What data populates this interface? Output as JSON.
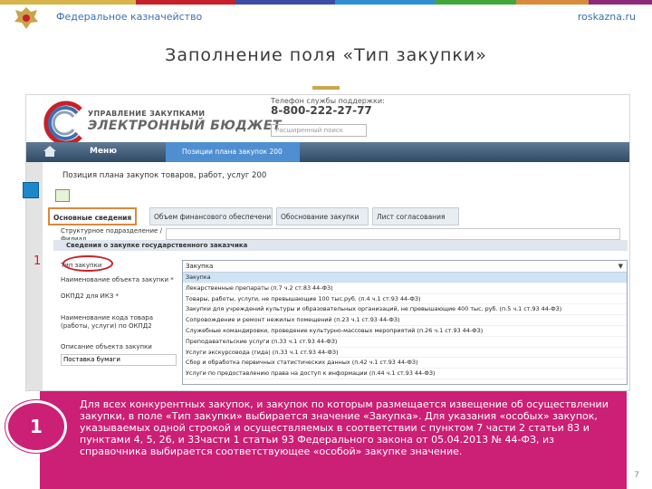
{
  "header": {
    "org_name": "Федеральное казначейство",
    "site": "roskazna.ru",
    "stripe_colors": [
      "#d8b54a",
      "#c8202a",
      "#3d4ea8",
      "#2e8fd6",
      "#41a73b",
      "#d98a3a",
      "#8e2a7b"
    ]
  },
  "title": "Заполнение поля «Тип закупки»",
  "app": {
    "logo_top": "УПРАВЛЕНИЕ ЗАКУПКАМИ",
    "logo_main": "ЭЛЕКТРОННЫЙ БЮДЖЕТ",
    "support_label": "Телефон службы поддержки:",
    "support_phone": "8-800-222-27-77",
    "search_placeholder": "Расширенный поиск",
    "menu_label": "Меню",
    "active_tab": "Позиции плана закупок 200",
    "form_title": "Позиция плана закупок товаров, работ, услуг 200",
    "tabs": [
      "Основные сведения",
      "Объем финансового обеспечения",
      "Обоснование закупки",
      "Лист согласования"
    ],
    "rows": {
      "structural_unit": "Структурное подразделение / Филиал",
      "section": "Сведения о закупке государственного заказчика",
      "purchase_type": "Тип закупки",
      "object_name": "Наименование объекта закупки *",
      "okpd_label": "ОКПД2 для ИКЗ *",
      "goods_code": "Наименование кода товара (работы, услуги) по ОКПД2",
      "description": "Описание объекта закупки",
      "description_value": "Поставка бумаги"
    },
    "dropdown": {
      "selected": "Закупка",
      "items": [
        "Закупка",
        "Лекарственные препараты (п.7 ч.2 ст.83 44-ФЗ)",
        "Товары, работы, услуги, не превышающие 100 тыс.руб. (п.4 ч.1 ст.93 44-ФЗ)",
        "Закупки для учреждений культуры и образовательных организаций, не превышающие 400 тыс. руб. (п.5 ч.1 ст.93 44-ФЗ)",
        "Сопровождение и ремонт нежилых помещений (п.23 ч.1 ст.93 44-ФЗ)",
        "Служебные командировки, проведение культурно-массовых мероприятий (п.26 ч.1 ст.93 44-ФЗ)",
        "Преподавательские услуги (п.33 ч.1 ст.93 44-ФЗ)",
        "Услуги экскурсовода (гида) (п.33 ч.1 ст.93 44-ФЗ)",
        "Сбор и обработка первичных статистических данных (п.42 ч.1 ст.93 44-ФЗ)",
        "Услуги по предоставлению права на доступ к информации (п.44 ч.1 ст.93 44-ФЗ)"
      ]
    }
  },
  "callout": {
    "number": "1",
    "text": "Для всех конкурентных закупок, и закупок по которым размещается извещение об осуществлении закупки, в поле «Тип закупки» выбирается значение «Закупка». Для указания «особых» закупок, указываемых одной строкой и осуществляемых в соответствии с пунктом 7 части 2 статьи 83 и пунктами 4, 5, 26, и 33части 1 статьи 93 Федерального закона от 05.04.2013 № 44-ФЗ, из справочника выбирается соответствующее «особой» закупке значение."
  },
  "marker_label": "1",
  "page_number": "7"
}
